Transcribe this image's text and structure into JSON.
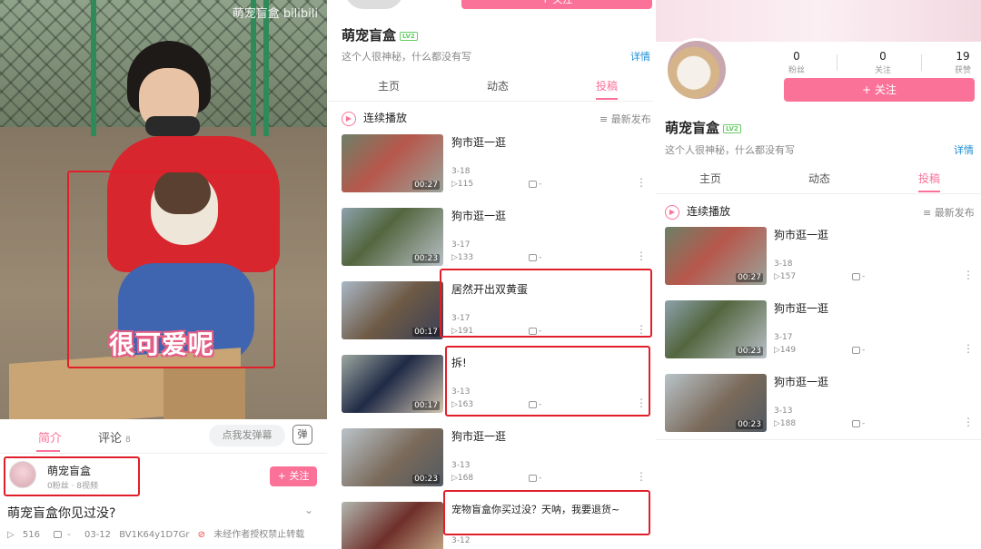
{
  "panel1": {
    "watermark": "萌宠盲盒 bilibili",
    "caption": "很可爱呢",
    "tabs": [
      {
        "label": "简介"
      },
      {
        "label": "评论",
        "count": "8"
      }
    ],
    "danmu_placeholder": "点我发弹幕",
    "danmu_icon_label": "弹",
    "uploader": {
      "name": "萌宠盲盒",
      "sub": "0粉丝 · 8视频"
    },
    "follow_label": "+ 关注",
    "video_title": "萌宠盲盒你见过没?",
    "stats": {
      "plays": "516",
      "danmaku": "-",
      "date": "03-12",
      "bvid": "BV1K64y1D7Gr",
      "notice": "未经作者授权禁止转载"
    }
  },
  "panel2": {
    "top_button_label": "+ 关注",
    "name": "萌宠盲盒",
    "level": "LV2",
    "bio": "这个人很神秘，什么都没有写",
    "detail": "详情",
    "tabs": [
      "主页",
      "动态",
      "投稿"
    ],
    "play_all": "连续播放",
    "sort": "最新发布",
    "videos": [
      {
        "title": "狗市逛一逛",
        "date": "3-18",
        "plays": "115",
        "danmaku": "-",
        "duration": "00:27"
      },
      {
        "title": "狗市逛一逛",
        "date": "3-17",
        "plays": "133",
        "danmaku": "-",
        "duration": "00:23"
      },
      {
        "title": "居然开出双黄蛋",
        "date": "3-17",
        "plays": "191",
        "danmaku": "-",
        "duration": "00:17"
      },
      {
        "title": "拆!",
        "date": "3-13",
        "plays": "163",
        "danmaku": "-",
        "duration": "00:17"
      },
      {
        "title": "狗市逛一逛",
        "date": "3-13",
        "plays": "168",
        "danmaku": "-",
        "duration": "00:23"
      },
      {
        "title": "宠物盲盒你买过没？天呐，我要退货~",
        "date": "3-12",
        "plays": "",
        "danmaku": "",
        "duration": ""
      }
    ]
  },
  "panel3": {
    "stats": [
      {
        "value": "0",
        "label": "粉丝"
      },
      {
        "value": "0",
        "label": "关注"
      },
      {
        "value": "19",
        "label": "获赞"
      }
    ],
    "follow_label": "+ 关注",
    "name": "萌宠盲盒",
    "level": "LV2",
    "bio": "这个人很神秘，什么都没有写",
    "detail": "详情",
    "tabs": [
      "主页",
      "动态",
      "投稿"
    ],
    "play_all": "连续播放",
    "sort": "最新发布",
    "videos": [
      {
        "title": "狗市逛一逛",
        "date": "3-18",
        "plays": "157",
        "danmaku": "-",
        "duration": "00:27"
      },
      {
        "title": "狗市逛一逛",
        "date": "3-17",
        "plays": "149",
        "danmaku": "-",
        "duration": "00:23"
      },
      {
        "title": "狗市逛一逛",
        "date": "3-13",
        "plays": "188",
        "danmaku": "-",
        "duration": "00:23"
      }
    ]
  },
  "colors": {
    "accent": "#fb7299",
    "highlight": "#e11f2a",
    "link": "#1b8dd6"
  }
}
